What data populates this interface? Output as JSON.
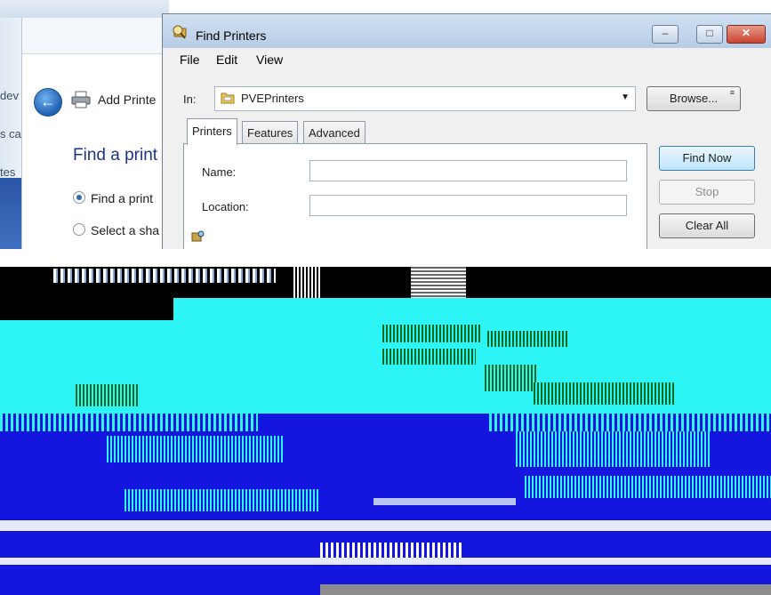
{
  "background_window": {
    "title": "Add Printe",
    "heading": "Find a print",
    "options": [
      {
        "label": "Find a print",
        "selected": true
      },
      {
        "label": "Select a sha",
        "selected": false
      }
    ],
    "edge_texts": [
      "dev",
      "s ca",
      "tes"
    ]
  },
  "dialog": {
    "title": "Find Printers",
    "caption_buttons": {
      "minimize": "–",
      "maximize": "□",
      "close": "✕"
    },
    "menu": [
      "File",
      "Edit",
      "View"
    ],
    "in_label": "In:",
    "location_value": "PVEPrinters",
    "browse_label": "Browse...",
    "tabs": [
      {
        "label": "Printers",
        "active": true
      },
      {
        "label": "Features",
        "active": false
      },
      {
        "label": "Advanced",
        "active": false
      }
    ],
    "fields": {
      "name_label": "Name:",
      "name_value": "",
      "location_label": "Location:",
      "location_value": ""
    },
    "buttons": {
      "find_now": "Find Now",
      "stop": "Stop",
      "clear_all": "Clear All"
    }
  },
  "icons": {
    "back": "back-arrow-icon",
    "printer": "printer-icon",
    "find_printers": "find-printers-icon",
    "folder": "folder-icon",
    "dropdown": "chevron-down-icon"
  },
  "colors": {
    "glitch_cyan": "#2ef5f5",
    "glitch_blue": "#1515e0",
    "glitch_black": "#000000",
    "heading_blue": "#1e3287"
  }
}
